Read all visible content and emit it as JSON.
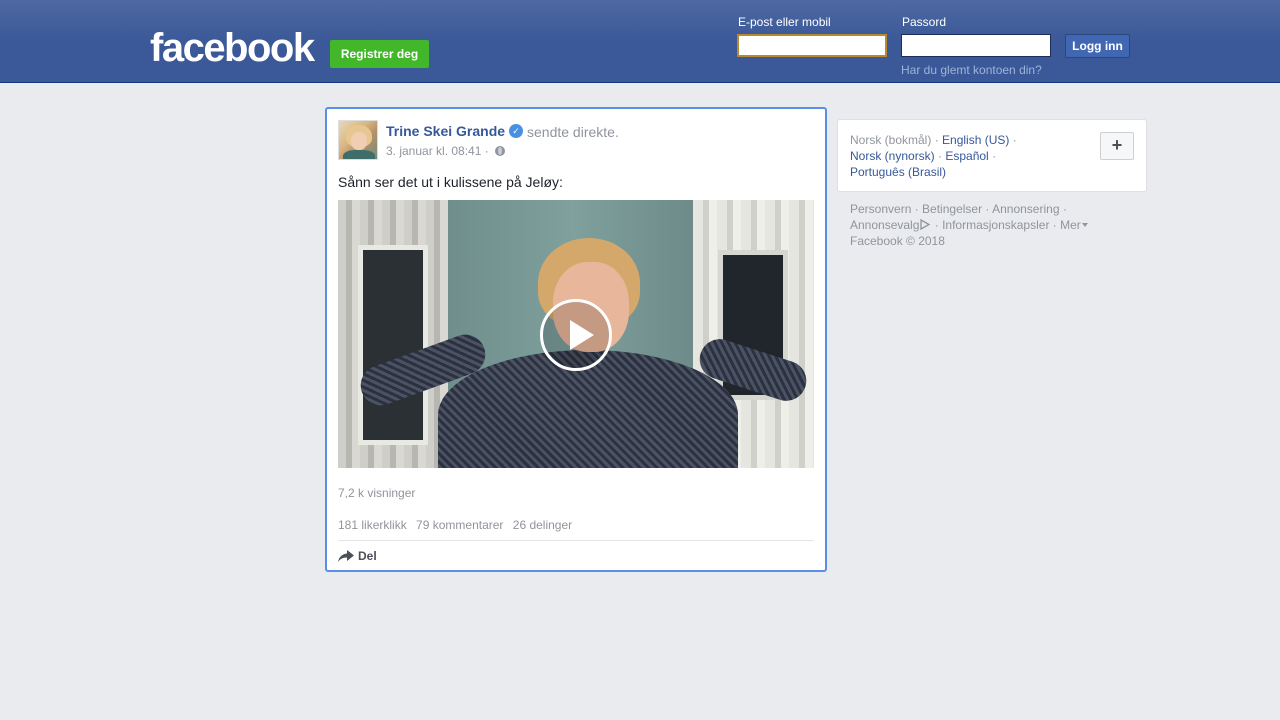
{
  "header": {
    "logo": "facebook",
    "register_label": "Registrer deg",
    "email_label": "E-post eller mobil",
    "email_value": "",
    "password_label": "Passord",
    "password_value": "",
    "login_label": "Logg inn",
    "forgot_link": "Har du glemt kontoen din?"
  },
  "post": {
    "author": "Trine Skei Grande",
    "action": "sendte direkte.",
    "timestamp": "3. januar kl. 08:41 ·",
    "text": "Sånn ser det ut i kulissene på Jeløy:",
    "views": "7,2 k visninger",
    "likes": "181 likerklikk",
    "comments": "79 kommentarer",
    "shares": "26 delinger",
    "share_label": "Del"
  },
  "languages": {
    "current": "Norsk (bokmål)",
    "items": [
      "English (US)",
      "Norsk (nynorsk)",
      "Español",
      "Português (Brasil)"
    ],
    "add_label": "+"
  },
  "footer": {
    "links": [
      "Personvern",
      "Betingelser",
      "Annonsering",
      "Annonsevalg",
      "Informasjonskapsler",
      "Mer"
    ],
    "copyright": "Facebook © 2018"
  },
  "colors": {
    "brand_blue": "#3b5998",
    "link_blue": "#365899",
    "green": "#42b72a",
    "focus_border": "#5b8ee6"
  }
}
